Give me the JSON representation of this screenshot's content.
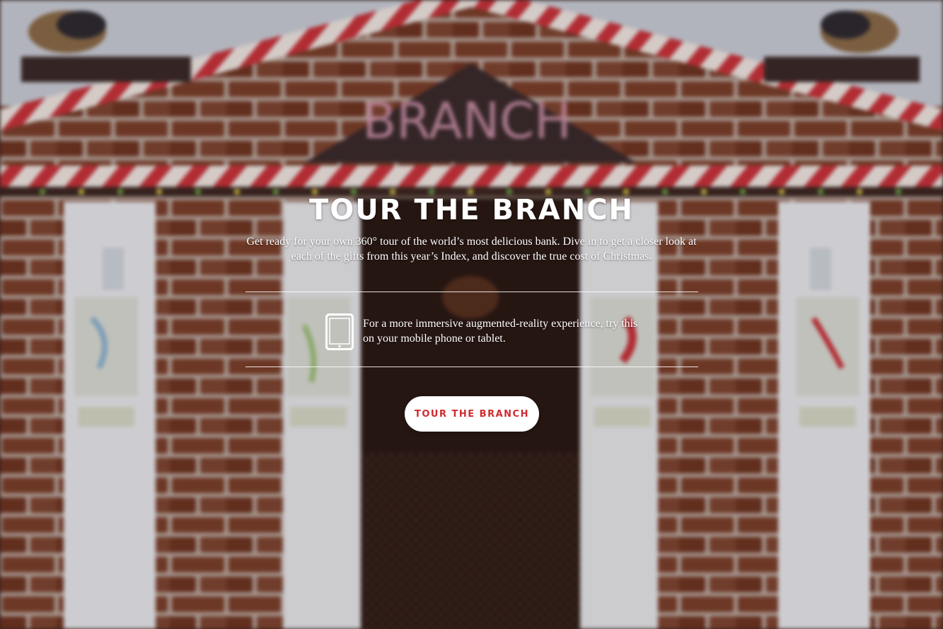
{
  "hero": {
    "title": "TOUR THE BRANCH",
    "intro": "Get ready for your own 360° tour of the world’s most delicious bank. Dive in to get a closer look at each of the gifts from this year’s Index, and discover the true cost of Christmas.",
    "mobile_note": "For a more immersive augmented-reality experience, try this on your mobile phone or tablet.",
    "cta_label": "TOUR THE BRANCH",
    "icons": {
      "device": "tablet-icon"
    }
  },
  "background": {
    "sign_text": "BRANCH",
    "colors": {
      "sky": "#c9ccd6",
      "brick": "#7a3e2a",
      "mortar": "#b9a79e",
      "candy_red": "#c8323a",
      "column": "#e8e8ec",
      "doorway": "#2a1814"
    }
  },
  "accent_color": "#cf2a2f"
}
